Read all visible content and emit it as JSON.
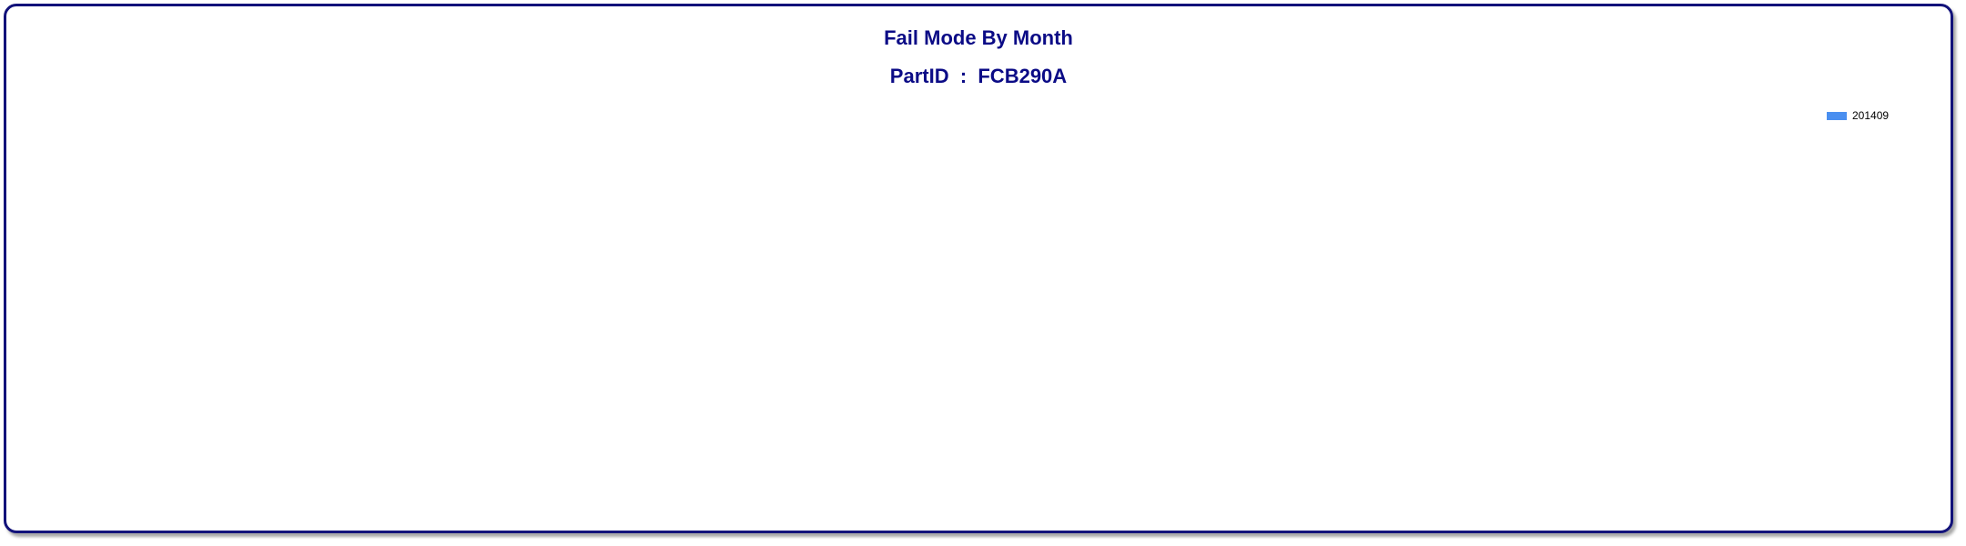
{
  "chart_data": {
    "type": "bar",
    "title": "Fail Mode By Month",
    "subtitle": "PartID  :  FCB290A",
    "categories": [],
    "series": [
      {
        "name": "201409",
        "values": [],
        "color": "#4a8ff0"
      }
    ],
    "legend_position": "top-right",
    "grid": false
  },
  "colors": {
    "frame_border": "#12127a",
    "title_text": "#0b0b86"
  }
}
